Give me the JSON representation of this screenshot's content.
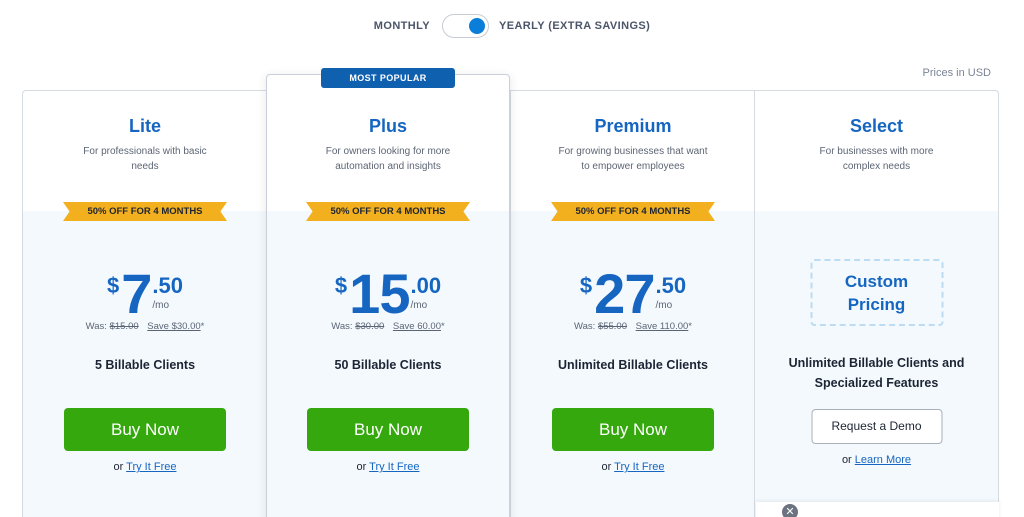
{
  "billing": {
    "monthly_label": "MONTHLY",
    "yearly_label": "YEARLY (EXTRA SAVINGS)",
    "selected": "yearly"
  },
  "prices_note": "Prices in USD",
  "plans": [
    {
      "name": "Lite",
      "description": "For professionals with basic needs",
      "ribbon": "50% OFF FOR 4 MONTHS",
      "currency": "$",
      "price_whole": "7",
      "price_cents": ".50",
      "per": "/mo",
      "was_label": "Was:",
      "was_price": "$15.00",
      "save": "Save $30.00",
      "save_mark": "*",
      "clients": "5 Billable Clients",
      "cta": "Buy Now",
      "or": "or",
      "alt_link": "Try It Free"
    },
    {
      "badge": "MOST POPULAR",
      "name": "Plus",
      "description": "For owners looking for more automation and insights",
      "ribbon": "50% OFF FOR 4 MONTHS",
      "currency": "$",
      "price_whole": "15",
      "price_cents": ".00",
      "per": "/mo",
      "was_label": "Was:",
      "was_price": "$30.00",
      "save": "Save 60.00",
      "save_mark": "*",
      "clients": "50 Billable Clients",
      "cta": "Buy Now",
      "or": "or",
      "alt_link": "Try It Free"
    },
    {
      "name": "Premium",
      "description": "For growing businesses that want to empower employees",
      "ribbon": "50% OFF FOR 4 MONTHS",
      "currency": "$",
      "price_whole": "27",
      "price_cents": ".50",
      "per": "/mo",
      "was_label": "Was:",
      "was_price": "$55.00",
      "save": "Save 110.00",
      "save_mark": "*",
      "clients": "Unlimited Billable Clients",
      "cta": "Buy Now",
      "or": "or",
      "alt_link": "Try It Free"
    },
    {
      "name": "Select",
      "description": "For businesses with more complex needs",
      "custom_line1": "Custom",
      "custom_line2": "Pricing",
      "clients_line1": "Unlimited Billable Clients and",
      "clients_line2": "Specialized Features",
      "cta": "Request a Demo",
      "or": "or",
      "alt_link": "Learn More"
    }
  ],
  "chat_close_glyph": "✕",
  "colors": {
    "brand_blue": "#1666c1",
    "cta_green": "#35a80d",
    "ribbon_yellow": "#f3b01e",
    "toggle_blue": "#0a7ed8"
  }
}
